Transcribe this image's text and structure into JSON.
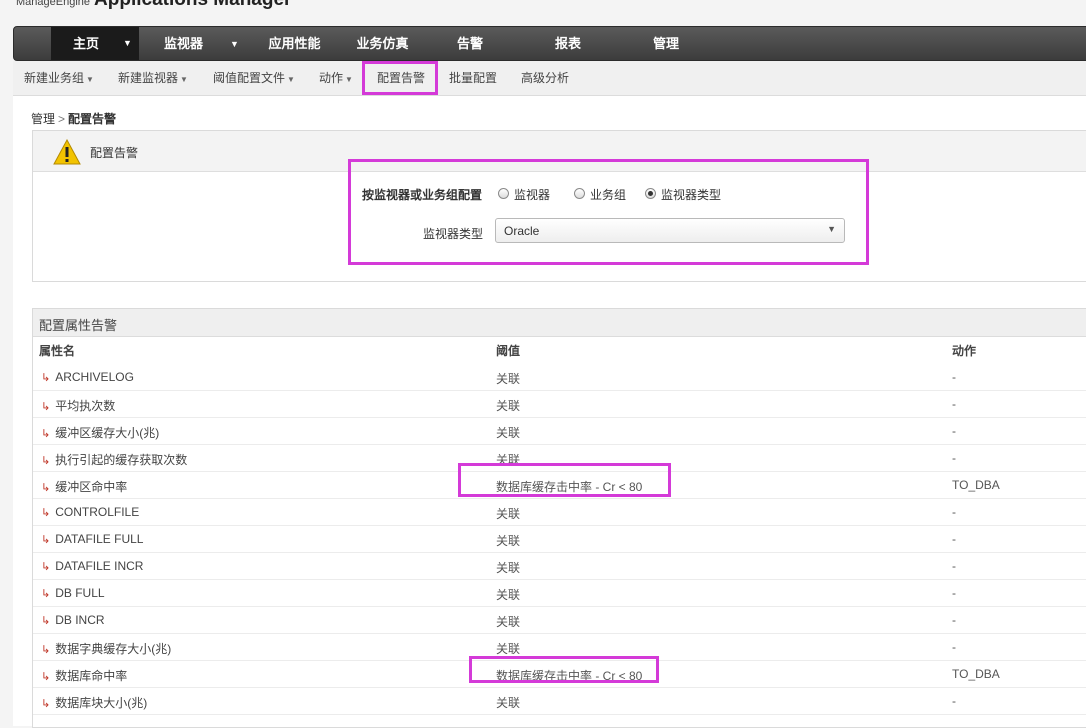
{
  "brand": {
    "vendor": "ManageEngine",
    "product": "Applications Manager"
  },
  "mainnav": [
    {
      "label": "主页"
    },
    {
      "label": "监视器"
    },
    {
      "label": "应用性能"
    },
    {
      "label": "业务仿真"
    },
    {
      "label": "告警"
    },
    {
      "label": "报表"
    },
    {
      "label": "管理"
    }
  ],
  "subnav": [
    {
      "label": "新建业务组"
    },
    {
      "label": "新建监视器"
    },
    {
      "label": "阈值配置文件"
    },
    {
      "label": "动作"
    },
    {
      "label": "配置告警"
    },
    {
      "label": "批量配置"
    },
    {
      "label": "高级分析"
    }
  ],
  "breadcrumb": {
    "root": "管理",
    "sep": ">",
    "current": "配置告警"
  },
  "config": {
    "title": "配置告警",
    "by_label": "按监视器或业务组配置",
    "options": [
      {
        "label": "监视器",
        "selected": false
      },
      {
        "label": "业务组",
        "selected": false
      },
      {
        "label": "监视器类型",
        "selected": true
      }
    ],
    "type_label": "监视器类型",
    "type_value": "Oracle"
  },
  "attributes": {
    "title": "配置属性告警",
    "columns": [
      "属性名",
      "阈值",
      "动作"
    ],
    "rows": [
      {
        "name": "ARCHIVELOG",
        "threshold": "关联",
        "action": "-"
      },
      {
        "name": "平均执次数",
        "threshold": "关联",
        "action": "-"
      },
      {
        "name": "缓冲区缓存大小(兆)",
        "threshold": "关联",
        "action": "-"
      },
      {
        "name": "执行引起的缓存获取次数",
        "threshold": "关联",
        "action": "-"
      },
      {
        "name": "缓冲区命中率",
        "threshold": "数据库缓存击中率 - Cr < 80",
        "action": "TO_DBA"
      },
      {
        "name": "CONTROLFILE",
        "threshold": "关联",
        "action": "-"
      },
      {
        "name": "DATAFILE FULL",
        "threshold": "关联",
        "action": "-"
      },
      {
        "name": "DATAFILE INCR",
        "threshold": "关联",
        "action": "-"
      },
      {
        "name": "DB FULL",
        "threshold": "关联",
        "action": "-"
      },
      {
        "name": "DB INCR",
        "threshold": "关联",
        "action": "-"
      },
      {
        "name": "数据字典缓存大小(兆)",
        "threshold": "关联",
        "action": "-"
      },
      {
        "name": "数据库命中率",
        "threshold": "数据库缓存击中率 - Cr < 80",
        "action": "TO_DBA"
      },
      {
        "name": "数据库块大小(兆)",
        "threshold": "关联",
        "action": "-"
      }
    ]
  },
  "icons": {
    "row_arrow": "↳",
    "warning": "warning-icon",
    "dropdown": "▼",
    "menu_caret": "▾"
  },
  "colors": {
    "highlight": "#d43ad8",
    "nav_dark": "#3c3c3c",
    "row_arrow": "#c0392b"
  }
}
